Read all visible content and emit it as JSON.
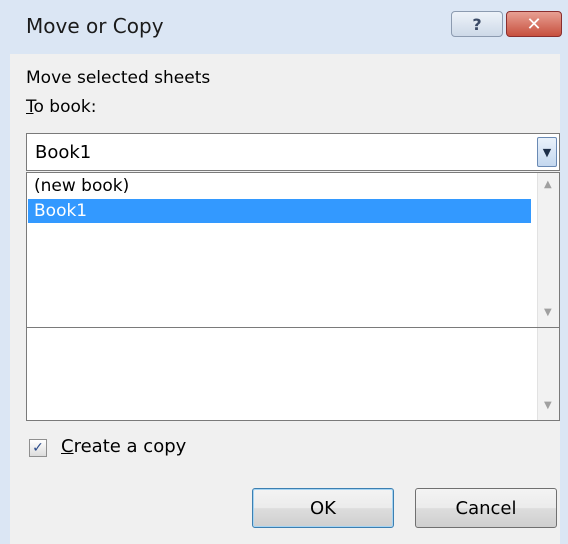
{
  "window": {
    "title": "Move or Copy",
    "help_glyph": "?",
    "close_glyph": "✕"
  },
  "labels": {
    "move_selected": "Move selected sheets",
    "to_book_accel": "T",
    "to_book_rest": "o book:"
  },
  "to_book": {
    "selected": "Book1",
    "dropdown_glyph": "▼"
  },
  "book_list": {
    "items": [
      {
        "label": "(new book)",
        "selected": false
      },
      {
        "label": "Book1",
        "selected": true
      }
    ]
  },
  "copy_option": {
    "checked": true,
    "check_glyph": "✓",
    "label_accel": "C",
    "label_rest": "reate a copy"
  },
  "buttons": {
    "ok": "OK",
    "cancel": "Cancel"
  },
  "scroll_glyphs": {
    "up": "▲",
    "down": "▼"
  },
  "colors": {
    "selection": "#3399ff",
    "title_bar": "#dbe6f4",
    "close_button": "#c7503e"
  }
}
